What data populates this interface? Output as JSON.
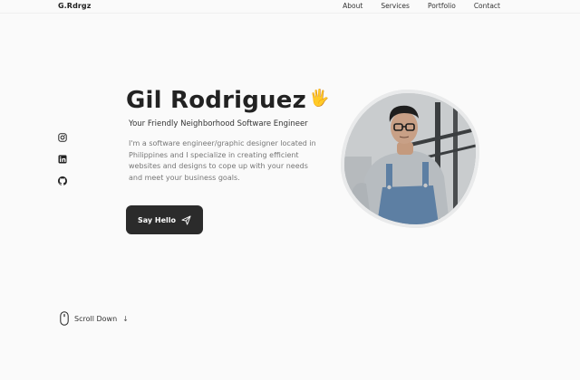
{
  "header": {
    "logo": "G.Rdrgz",
    "nav": [
      "About",
      "Services",
      "Portfolio",
      "Contact"
    ]
  },
  "social": {
    "items": [
      {
        "icon": "instagram-icon"
      },
      {
        "icon": "linkedin-icon"
      },
      {
        "icon": "github-icon"
      }
    ]
  },
  "hero": {
    "name": "Gil Rodriguez",
    "wave": "🖐",
    "subtitle": "Your Friendly Neighborhood Software Engineer",
    "description": "I'm a software engineer/graphic designer located in Philippines and I specialize in creating efficient websites and designs to cope up with your needs and meet your business goals.",
    "cta_label": "Say Hello"
  },
  "scroll": {
    "label": "Scroll Down",
    "arrow": "↓"
  }
}
